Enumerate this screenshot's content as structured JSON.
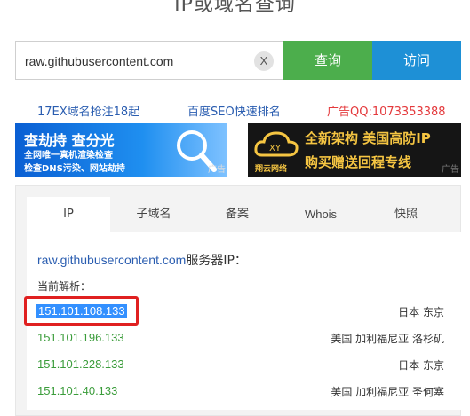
{
  "header": {
    "title": "IP或域名查询"
  },
  "search": {
    "value": "raw.githubusercontent.com",
    "clear_label": "X",
    "query_label": "查询",
    "visit_label": "访问"
  },
  "promos": [
    {
      "text": "17EX域名抢注18起"
    },
    {
      "text": "百度SEO快速排名"
    },
    {
      "text": "广告QQ:1073353388"
    }
  ],
  "banners": {
    "left": {
      "main": "查劫持 查分光",
      "sub1": "全网唯一真机渲染检查",
      "sub2": "检查DNS污染、网站劫持",
      "ad": "广告"
    },
    "right": {
      "logo_text": "翔云网络",
      "line1": "全新架构 美国高防IP",
      "line2": "购买赠送回程专线",
      "ad": "广告"
    }
  },
  "tabs": [
    {
      "label": "IP"
    },
    {
      "label": "子域名"
    },
    {
      "label": "备案"
    },
    {
      "label": "Whois"
    },
    {
      "label": "快照"
    }
  ],
  "result": {
    "domain": "raw.githubusercontent.com",
    "suffix": "服务器IP：",
    "current_label": "当前解析：",
    "ips": [
      {
        "ip": "151.101.108.133",
        "location": "日本 东京"
      },
      {
        "ip": "151.101.196.133",
        "location": "美国 加利福尼亚 洛杉矶"
      },
      {
        "ip": "151.101.228.133",
        "location": "日本 东京"
      },
      {
        "ip": "151.101.40.133",
        "location": "美国 加利福尼亚 圣何塞"
      }
    ]
  },
  "colors": {
    "query_button": "#4cae4c",
    "visit_button": "#1e90d6",
    "ip_text": "#3a9c3a",
    "highlight_border": "#e02020",
    "selection": "#3390ff"
  }
}
